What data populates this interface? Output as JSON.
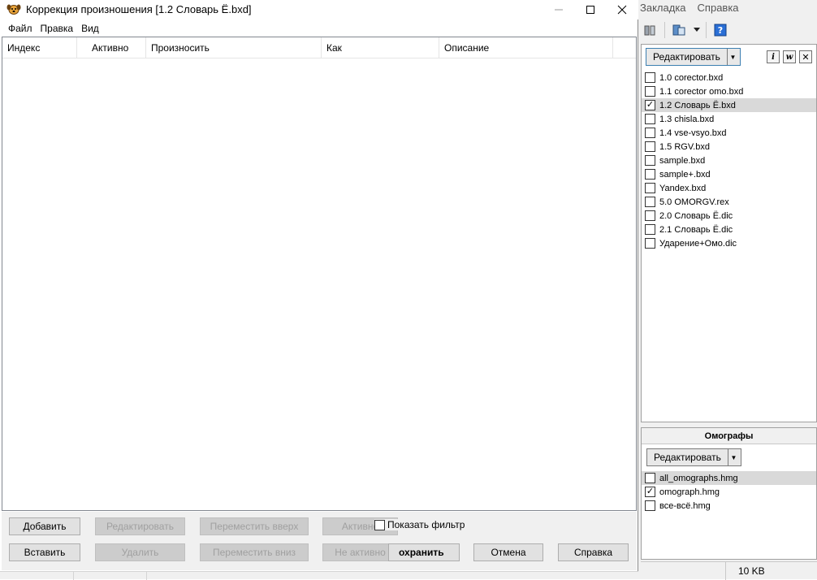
{
  "dialog": {
    "title": "Коррекция произношения [1.2 Словарь Ё.bxd]",
    "menu": [
      "Файл",
      "Правка",
      "Вид"
    ],
    "columns": [
      "Индекс",
      "Активно",
      "Произносить",
      "Как",
      "Описание"
    ],
    "buttons": {
      "add": "Добавить",
      "edit": "Редактировать",
      "move_up": "Переместить вверх",
      "active": "Активно",
      "insert": "Вставить",
      "delete": "Удалить",
      "move_down": "Переместить вниз",
      "inactive": "Не активно",
      "save": "Сохранить",
      "save_visible": "охранить",
      "cancel": "Отмена",
      "help": "Справка"
    },
    "show_filter": "Показать фильтр",
    "show_filter_checked": false
  },
  "bg_app": {
    "menu": [
      "Закладка",
      "Справка"
    ],
    "edit_label": "Редактировать",
    "files": [
      {
        "name": "1.0 corector.bxd",
        "checked": false
      },
      {
        "name": "1.1 corector omo.bxd",
        "checked": false
      },
      {
        "name": "1.2 Словарь Ё.bxd",
        "checked": true
      },
      {
        "name": "1.3 chisla.bxd",
        "checked": false
      },
      {
        "name": "1.4 vse-vsyo.bxd",
        "checked": false
      },
      {
        "name": "1.5 RGV.bxd",
        "checked": false
      },
      {
        "name": "sample.bxd",
        "checked": false
      },
      {
        "name": "sample+.bxd",
        "checked": false
      },
      {
        "name": "Yandex.bxd",
        "checked": false
      },
      {
        "name": "5.0 OMORGV.rex",
        "checked": false
      },
      {
        "name": "2.0 Словарь Ё.dic",
        "checked": false
      },
      {
        "name": "2.1 Словарь Ё.dic",
        "checked": false
      },
      {
        "name": "Ударение+Омо.dic",
        "checked": false
      }
    ],
    "omographs": {
      "title": "Омографы",
      "edit_label": "Редактировать",
      "files": [
        {
          "name": "all_omographs.hmg",
          "checked": false
        },
        {
          "name": "omograph.hmg",
          "checked": true
        },
        {
          "name": "все-всё.hmg",
          "checked": false
        }
      ]
    },
    "status_size": "10 KB"
  }
}
